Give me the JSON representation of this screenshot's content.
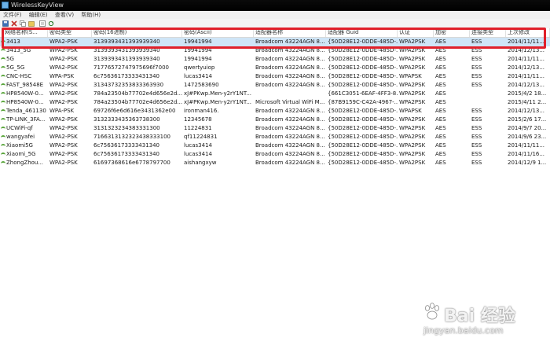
{
  "window": {
    "title": "WirelessKeyView"
  },
  "menu": {
    "items": [
      "文件(F)",
      "编辑(E)",
      "查看(V)",
      "帮助(H)"
    ]
  },
  "toolbar": {
    "icons": [
      "save-icon",
      "delete-icon",
      "copy-icon",
      "export-icon",
      "properties-icon",
      "refresh-icon"
    ]
  },
  "table": {
    "columns": [
      "网络名称(S...",
      "密码类型",
      "密码(16进制)",
      "密码(Ascii)",
      "适配器名称",
      "适配器 Guid",
      "认证",
      "加密",
      "连接类型",
      "上次修改"
    ],
    "rows": [
      [
        "3413",
        "WPA2-PSK",
        "3139393431393939340",
        "19941994",
        "Broadcom 43224AGN 8...",
        "{50D28E12-0DDE-485D-...",
        "WPA2PSK",
        "AES",
        "ESS",
        "2014/11/11..."
      ],
      [
        "3413_5G",
        "WPA2-PSK",
        "3139393431393939340",
        "19941994",
        "Broadcom 43224AGN 8...",
        "{50D28E12-0DDE-485D-...",
        "WPA2PSK",
        "AES",
        "ESS",
        "2014/12/13..."
      ],
      [
        "5G",
        "WPA2-PSK",
        "3139393431393939340",
        "19941994",
        "Broadcom 43224AGN 8...",
        "{50D28E12-0DDE-485D-...",
        "WPA2PSK",
        "AES",
        "ESS",
        "2014/11/11..."
      ],
      [
        "5G_5G",
        "WPA2-PSK",
        "71776572747975696f7000",
        "qwertyuiop",
        "Broadcom 43224AGN 8...",
        "{50D28E12-0DDE-485D-...",
        "WPA2PSK",
        "AES",
        "ESS",
        "2014/12/13..."
      ],
      [
        "CNC-HSC",
        "WPA-PSK",
        "6c75636173333431340",
        "lucas3414",
        "Broadcom 43224AGN 8...",
        "{50D28E12-0DDE-485D-...",
        "WPAPSK",
        "AES",
        "ESS",
        "2014/11/11..."
      ],
      [
        "FAST_98548E",
        "WPA2-PSK",
        "31343732353833363930",
        "1472583690",
        "Broadcom 43224AGN 8...",
        "{50D28E12-0DDE-485D-...",
        "WPA2PSK",
        "AES",
        "ESS",
        "2014/12/13..."
      ],
      [
        "HP8540W-0...",
        "WPA2-PSK",
        "784a23504b77702e4d656e2d...",
        "xJ#PKwp.Men-y2rY1NT...",
        "",
        "{661C3051-6EAF-4FF3-8...",
        "WPA2PSK",
        "AES",
        "",
        "2015/4/2 18..."
      ],
      [
        "HP8540W-0...",
        "WPA2-PSK",
        "784a23504b77702e4d656e2d...",
        "xJ#PKwp.Men-y2rY1NT...",
        "Microsoft Virtual WiFi M...",
        "{87B9159C-C42A-4967-...",
        "WPA2PSK",
        "AES",
        "",
        "2015/4/11 2..."
      ],
      [
        "Tenda_461130",
        "WPA-PSK",
        "69726f6e6d616e3431362e00",
        "ironman416.",
        "Broadcom 43224AGN 8...",
        "{50D28E12-0DDE-485D-...",
        "WPAPSK",
        "AES",
        "ESS",
        "2014/12/13..."
      ],
      [
        "TP-LINK_3FA...",
        "WPA2-PSK",
        "3132333435363738300",
        "12345678",
        "Broadcom 43224AGN 8...",
        "{50D28E12-0DDE-485D-...",
        "WPA2PSK",
        "AES",
        "ESS",
        "2015/2/6 17..."
      ],
      [
        "UCWiFi-qf",
        "WPA2-PSK",
        "3131323234383331300",
        "11224831",
        "Broadcom 43224AGN 8...",
        "{50D28E12-0DDE-485D-...",
        "WPA2PSK",
        "AES",
        "ESS",
        "2014/9/7 20..."
      ],
      [
        "wangyafei",
        "WPA2-PSK",
        "7166313132323438333100",
        "qf11224831",
        "Broadcom 43224AGN 8...",
        "{50D28E12-0DDE-485D-...",
        "WPA2PSK",
        "AES",
        "ESS",
        "2014/9/6 23..."
      ],
      [
        "Xiaomi5G",
        "WPA2-PSK",
        "6c75636173333431340",
        "lucas3414",
        "Broadcom 43224AGN 8...",
        "{50D28E12-0DDE-485D-...",
        "WPA2PSK",
        "AES",
        "ESS",
        "2014/11/11..."
      ],
      [
        "Xiaomi_5G",
        "WPA2-PSK",
        "6c75636173333431340",
        "lucas3414",
        "Broadcom 43224AGN 8...",
        "{50D28E12-0DDE-485D-...",
        "WPA2PSK",
        "AES",
        "ESS",
        "2014/11/16..."
      ],
      [
        "ZhongZhou...",
        "WPA2-PSK",
        "61697368616e6778797700",
        "aishangxyw",
        "Broadcom 43224AGN 8...",
        "{50D28E12-0DDE-485D-...",
        "WPA2PSK",
        "AES",
        "ESS",
        "2014/12/9 1..."
      ]
    ]
  },
  "watermark": {
    "brand": "Bai 经验",
    "url": "jingyan.baidu.com"
  },
  "colors": {
    "highlight_box": "#e0202a",
    "selected_row": "#cfe5f7",
    "wifi_icon": "#59a43b"
  }
}
